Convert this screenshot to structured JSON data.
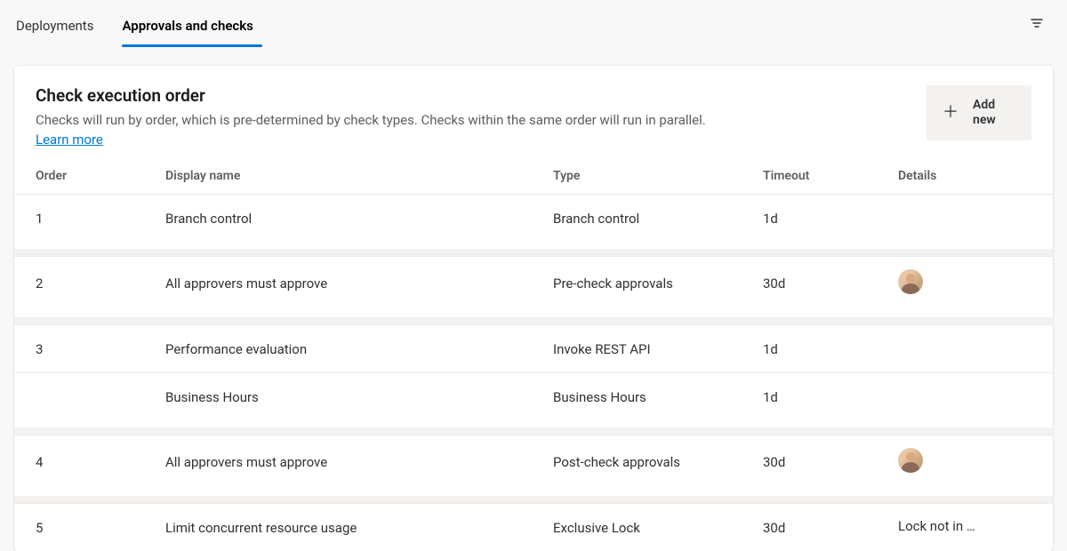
{
  "tabs": {
    "deployments": "Deployments",
    "approvals": "Approvals and checks"
  },
  "header": {
    "title": "Check execution order",
    "description": "Checks will run by order, which is pre-determined by check types. Checks within the same order will run in parallel.",
    "learn_more": "Learn more",
    "add_new": "Add new"
  },
  "columns": {
    "order": "Order",
    "display_name": "Display name",
    "type": "Type",
    "timeout": "Timeout",
    "details": "Details"
  },
  "rows": {
    "r1": {
      "order": "1",
      "name": "Branch control",
      "type": "Branch control",
      "timeout": "1d",
      "details": "",
      "avatar": false
    },
    "r2": {
      "order": "2",
      "name": "All approvers must approve",
      "type": "Pre-check approvals",
      "timeout": "30d",
      "details": "",
      "avatar": true
    },
    "r3": {
      "order": "3",
      "name": "Performance evaluation",
      "type": "Invoke REST API",
      "timeout": "1d",
      "details": "",
      "avatar": false
    },
    "r4": {
      "order": "",
      "name": "Business Hours",
      "type": "Business Hours",
      "timeout": "1d",
      "details": "",
      "avatar": false
    },
    "r5": {
      "order": "4",
      "name": "All approvers must approve",
      "type": "Post-check approvals",
      "timeout": "30d",
      "details": "",
      "avatar": true
    },
    "r6": {
      "order": "5",
      "name": "Limit concurrent resource usage",
      "type": "Exclusive Lock",
      "timeout": "30d",
      "details": "Lock not in …",
      "avatar": false
    }
  }
}
